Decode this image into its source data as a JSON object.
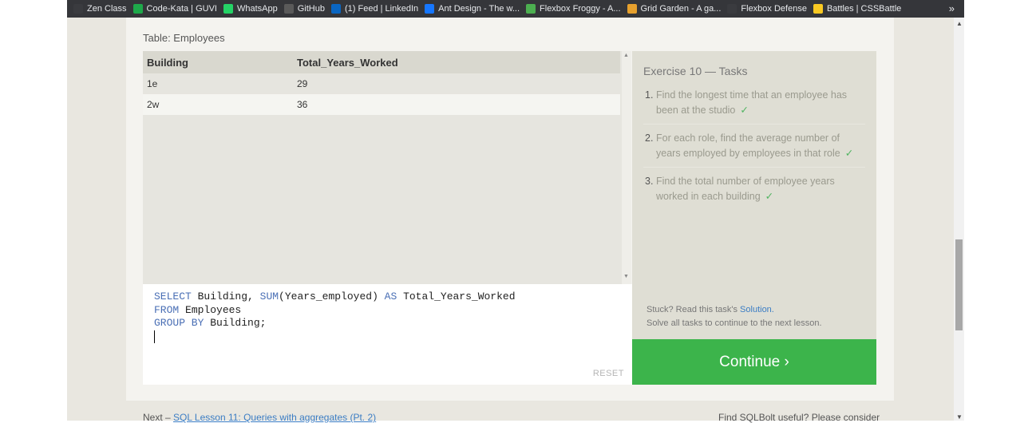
{
  "bookmarks": [
    {
      "label": "Zen Class",
      "icon": "zen-class-icon",
      "color": "#3a3b3f"
    },
    {
      "label": "Code-Kata | GUVI",
      "icon": "guvi-icon",
      "color": "#1ea94a"
    },
    {
      "label": "WhatsApp",
      "icon": "whatsapp-icon",
      "color": "#25d366"
    },
    {
      "label": "GitHub",
      "icon": "github-icon",
      "color": "#5a5a5a"
    },
    {
      "label": "(1) Feed | LinkedIn",
      "icon": "linkedin-icon",
      "color": "#0a66c2"
    },
    {
      "label": "Ant Design - The w...",
      "icon": "ant-design-icon",
      "color": "#1677ff"
    },
    {
      "label": "Flexbox Froggy - A...",
      "icon": "frog-icon",
      "color": "#4caf50"
    },
    {
      "label": "Grid Garden - A ga...",
      "icon": "carrot-icon",
      "color": "#e6a02d"
    },
    {
      "label": "Flexbox Defense",
      "icon": "flexbox-defense-icon",
      "color": "#3a3b3f"
    },
    {
      "label": "Battles | CSSBattle",
      "icon": "cssbattle-icon",
      "color": "#f9c922"
    }
  ],
  "bookmarks_more": "»",
  "table_caption": "Table: Employees",
  "result_table": {
    "columns": [
      "Building",
      "Total_Years_Worked"
    ],
    "rows": [
      [
        "1e",
        "29"
      ],
      [
        "2w",
        "36"
      ]
    ]
  },
  "editor": {
    "lines": [
      [
        {
          "t": "SELECT",
          "kw": true
        },
        {
          "t": " Building, ",
          "kw": false
        },
        {
          "t": "SUM",
          "kw": true
        },
        {
          "t": "(Years_employed) ",
          "kw": false
        },
        {
          "t": "AS",
          "kw": true
        },
        {
          "t": " Total_Years_Worked",
          "kw": false
        }
      ],
      [
        {
          "t": "FROM",
          "kw": true
        },
        {
          "t": " Employees",
          "kw": false
        }
      ],
      [
        {
          "t": "GROUP BY",
          "kw": true
        },
        {
          "t": " Building;",
          "kw": false
        }
      ]
    ],
    "reset_label": "RESET"
  },
  "tasks": {
    "title": "Exercise 10 — Tasks",
    "items": [
      {
        "num": "1.",
        "text": "Find the longest time that an employee has been at the studio",
        "done": "✓"
      },
      {
        "num": "2.",
        "text": "For each role, find the average number of years employed by employees in that role",
        "done": "✓"
      },
      {
        "num": "3.",
        "text": "Find the total number of employee years worked in each building",
        "done": "✓"
      }
    ],
    "stuck_prefix": "Stuck? Read this task's ",
    "solution_link": "Solution.",
    "stuck_line2": "Solve all tasks to continue to the next lesson.",
    "continue_label": "Continue ›",
    "continue_color": "#3cb44b"
  },
  "footer": {
    "next_prefix": "Next – ",
    "next_link": "SQL Lesson 11: Queries with aggregates (Pt. 2)",
    "right_text": "Find SQLBolt useful? Please consider"
  }
}
